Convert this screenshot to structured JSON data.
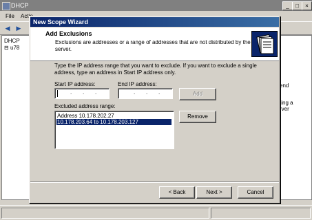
{
  "main_window": {
    "title": "DHCP",
    "menu": [
      "File",
      "Actio"
    ],
    "tree_root": "DHCP",
    "tree_child": "u78",
    "right_fragments": [
      "end",
      "ting a",
      "rver"
    ]
  },
  "wizard": {
    "title": "New Scope Wizard",
    "header_title": "Add Exclusions",
    "header_description": "Exclusions are addresses or a range of addresses that are not distributed by the server.",
    "instructions": "Type the IP address range that you want to exclude. If you want to exclude a single address, type an address in Start IP address only.",
    "start_ip_label": "Start IP address:",
    "end_ip_label": "End IP address:",
    "add_button": "Add",
    "excluded_label": "Excluded address range:",
    "excluded_items": [
      {
        "text": "Address 10.178.202.27",
        "selected": false
      },
      {
        "text": "10.178.203.64 to 10.178.203.127",
        "selected": true
      }
    ],
    "remove_button": "Remove",
    "back_button": "< Back",
    "next_button": "Next >",
    "cancel_button": "Cancel"
  },
  "colors": {
    "title_active": "#0a246a",
    "selection": "#0a246a",
    "dialog_face": "#d4d0c8"
  },
  "icons": [
    "app-icon",
    "minimize-icon",
    "maximize-icon",
    "close-icon",
    "back-arrow-icon",
    "forward-arrow-icon",
    "folder-icon"
  ]
}
